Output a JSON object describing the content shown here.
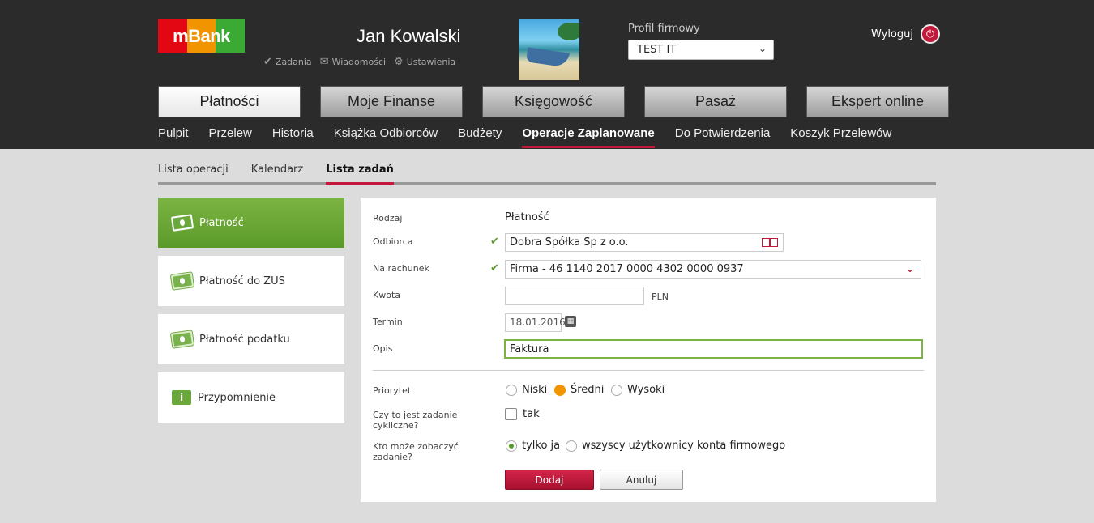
{
  "header": {
    "logo_text": "mBank",
    "user_name": "Jan Kowalski",
    "quicklinks": [
      {
        "label": "Zadania",
        "icon": "checkmark-icon"
      },
      {
        "label": "Wiadomości",
        "icon": "envelope-icon"
      },
      {
        "label": "Ustawienia",
        "icon": "gear-icon"
      }
    ],
    "profile_label": "Profil firmowy",
    "profile_value": "TEST IT",
    "logout_label": "Wyloguj"
  },
  "main_tabs": [
    {
      "label": "Płatności",
      "active": true
    },
    {
      "label": "Moje Finanse",
      "active": false
    },
    {
      "label": "Księgowość",
      "active": false
    },
    {
      "label": "Pasaż",
      "active": false
    },
    {
      "label": "Ekspert online",
      "active": false
    }
  ],
  "sub_nav": [
    {
      "label": "Pulpit",
      "active": false
    },
    {
      "label": "Przelew",
      "active": false
    },
    {
      "label": "Historia",
      "active": false
    },
    {
      "label": "Książka Odbiorców",
      "active": false
    },
    {
      "label": "Budżety",
      "active": false
    },
    {
      "label": "Operacje Zaplanowane",
      "active": true
    },
    {
      "label": "Do Potwierdzenia",
      "active": false
    },
    {
      "label": "Koszyk Przelewów",
      "active": false
    }
  ],
  "section_tabs": [
    {
      "label": "Lista operacji",
      "active": false
    },
    {
      "label": "Kalendarz",
      "active": false
    },
    {
      "label": "Lista zadań",
      "active": true
    }
  ],
  "sidebar": [
    {
      "label": "Płatność",
      "icon": "banknote-icon",
      "active": true
    },
    {
      "label": "Płatność do ZUS",
      "icon": "banknote-icon",
      "active": false
    },
    {
      "label": "Płatność podatku",
      "icon": "banknote-icon",
      "active": false
    },
    {
      "label": "Przypomnienie",
      "icon": "info-icon",
      "active": false
    }
  ],
  "form": {
    "rodzaj_label": "Rodzaj",
    "rodzaj_value": "Płatność",
    "odbiorca_label": "Odbiorca",
    "odbiorca_value": "Dobra Spółka Sp z o.o.",
    "rachunek_label": "Na rachunek",
    "rachunek_value": "Firma - 46 1140 2017 0000 4302 0000 0937",
    "kwota_label": "Kwota",
    "kwota_value": "",
    "currency": "PLN",
    "termin_label": "Termin",
    "termin_value": "18.01.2016",
    "opis_label": "Opis",
    "opis_value": "Faktura",
    "priorytet_label": "Priorytet",
    "priorytet_options": [
      "Niski",
      "Średni",
      "Wysoki"
    ],
    "priorytet_selected": "Średni",
    "cykliczne_label_1": "Czy to jest zadanie",
    "cykliczne_label_2": "cykliczne?",
    "cykliczne_option": "tak",
    "widocznosc_label_1": "Kto może zobaczyć",
    "widocznosc_label_2": "zadanie?",
    "widocznosc_options": [
      "tylko ja",
      "wszyscy użytkownicy konta firmowego"
    ],
    "widocznosc_selected": "tylko ja",
    "add_label": "Dodaj",
    "cancel_label": "Anuluj"
  },
  "colors": {
    "accent": "#c2183a",
    "green": "#5a9a2a",
    "orange": "#f29400",
    "header_bg": "#2b2b2b"
  }
}
